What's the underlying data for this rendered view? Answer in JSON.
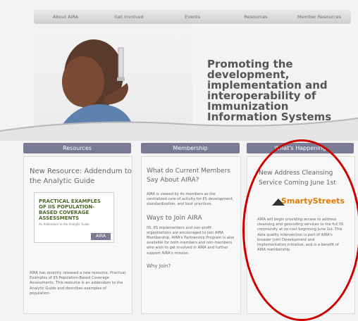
{
  "nav": {
    "items": [
      "About AIRA",
      "Get Involved",
      "Events",
      "Resources",
      "Member Resources"
    ]
  },
  "hero": {
    "title": "Promoting the development, implementation and interoperability of Immunization Information Systems"
  },
  "columns": {
    "resources": {
      "header": "Resources",
      "title": "New Resource: Addendum to the Analytic Guide",
      "cover": "PRACTICAL EXAMPLES OF IIS POPULATION-BASED COVERAGE ASSESSMENTS",
      "cover_sub": "An Addendum to the Analytic Guide",
      "cover_logo": "AIRA",
      "body": "AIRA has recently released a new resource, Practical Examples of IIS Population-Based Coverage Assessments. This resource is an addendum to the Analytic Guide and describes examples of population-"
    },
    "membership": {
      "header": "Membership",
      "title": "What do Current Members Say About AIRA?",
      "body": "AIRA is viewed by its members as the centralized core of activity for IIS development, standardization, and best practices.",
      "sub_title": "Ways to Join AIRA",
      "sub_body": "IIS, IIS implementers and non-profit organizations are encouraged to join AIRA Membership. AIRA's Partnership Program is also available for both members and non-members who wish to get involved in AIRA and further support AIRA's mission.",
      "footer": "Why Join?"
    },
    "happening": {
      "header": "What's Happening",
      "title": "New Address Cleansing Service Coming June 1st",
      "logo": "SmartyStreets",
      "body": "AIRA will begin providing access to address cleansing and geocoding services to the full IIS community at no cost beginning June 1st. This data quality intervention is part of AIRA's broader Joint Development and Implementation initiative, and is a benefit of AIRA membership"
    }
  },
  "colors": {
    "header_bg": "#7a7a95",
    "highlight": "#cc0000"
  }
}
